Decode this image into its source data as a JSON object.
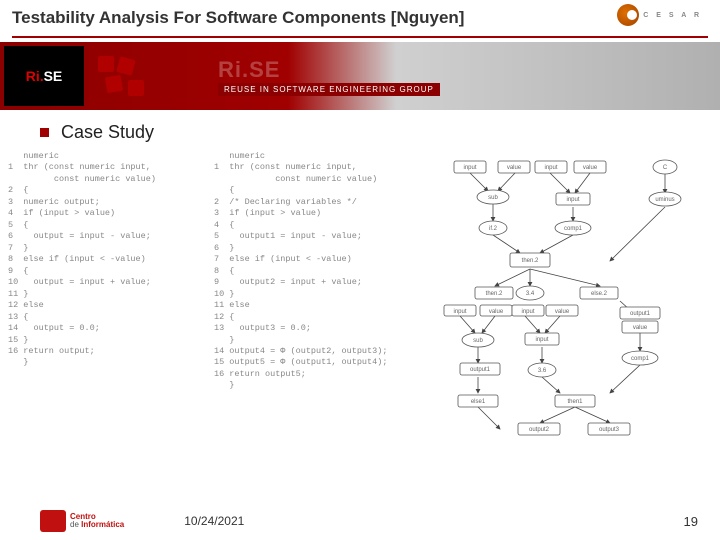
{
  "title": "Testability Analysis For Software Components [Nguyen]",
  "logo_cesar": "C E S A R",
  "banner": {
    "rise": "Ri.SE",
    "rise_faded": "Ri.SE",
    "subtitle": "REUSE IN SOFTWARE ENGINEERING GROUP"
  },
  "section": "Case Study",
  "code1": "   numeric\n1  thr (const numeric input,\n         const numeric value)\n2  {\n3  numeric output;\n4  if (input > value)\n5  {\n6    output = input - value;\n7  }\n8  else if (input < -value)\n9  {\n10   output = input + value;\n11 }\n12 else\n13 {\n14   output = 0.0;\n15 }\n16 return output;\n   }",
  "code2": "   numeric\n1  thr (const numeric input,\n            const numeric value)\n   {\n2  /* Declaring variables */\n3  if (input > value)\n4  {\n5    output1 = input - value;\n6  }\n7  else if (input < -value)\n8  {\n9    output2 = input + value;\n10 }\n11 else\n12 {\n13   output3 = 0.0;\n   }\n14 output4 = Φ (output2, output3);\n15 output5 = Φ (output1, output4);\n16 return output5;\n   }",
  "date": "10/24/2021",
  "page": "19",
  "footer_logo": "Centro\nde Informática",
  "diagram_nodes": {
    "n1": "input",
    "n2": "value",
    "n3": "C",
    "n4": "sub",
    "n5": "input",
    "n6": "uminus",
    "n7": "if.2",
    "n8": "comp1",
    "n9": "then.2",
    "n10": "3.4",
    "n11": "else.2",
    "n12": "input",
    "n13": "value",
    "n14": "input",
    "n15": "value",
    "n16": "output1",
    "n17": "sub",
    "n18": "input",
    "n19": "value",
    "n20": "output1",
    "n21": "3.6",
    "n22": "comp1",
    "n23": "then1",
    "n24": "else1",
    "n25": "output2",
    "n26": "output3"
  }
}
